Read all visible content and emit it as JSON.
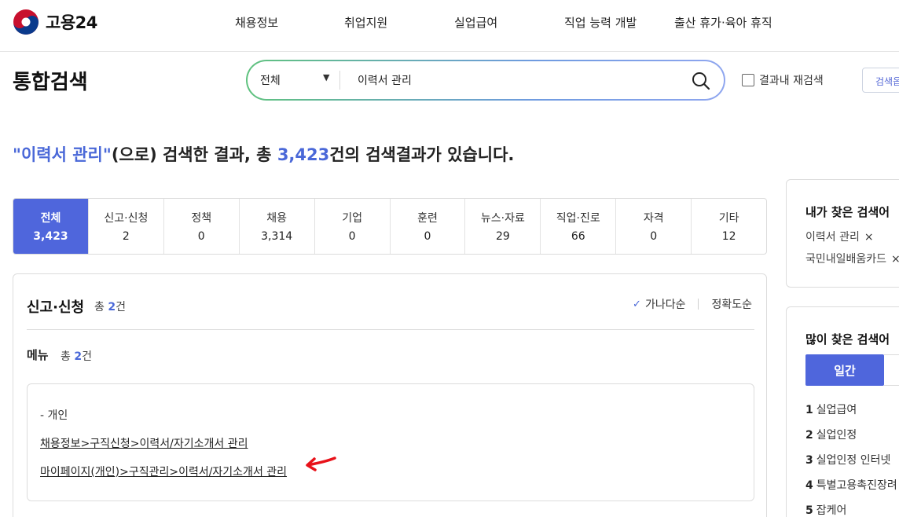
{
  "brand": {
    "name": "고용24",
    "accent": "#4f66dc"
  },
  "gnb": [
    "채용정보",
    "취업지원",
    "실업급여",
    "직업 능력 개발",
    "출산 휴가·육아 휴직"
  ],
  "page_title": "통합검색",
  "search": {
    "scope": "전체",
    "query": "이력서 관리",
    "recheck_label": "결과내 재검색",
    "option_label": "검색옵"
  },
  "result_summary": {
    "open_quote": "\"",
    "keyword": "이력서 관리",
    "close_quote": "\"",
    "mid": "(으로) 검색한 결과, 총 ",
    "total": "3,423",
    "tail": "건의 검색결과가 있습니다."
  },
  "tabs": [
    {
      "label": "전체",
      "count": "3,423",
      "active": true
    },
    {
      "label": "신고·신청",
      "count": "2"
    },
    {
      "label": "정책",
      "count": "0"
    },
    {
      "label": "채용",
      "count": "3,314"
    },
    {
      "label": "기업",
      "count": "0"
    },
    {
      "label": "훈련",
      "count": "0"
    },
    {
      "label": "뉴스·자료",
      "count": "29"
    },
    {
      "label": "직업·진로",
      "count": "66"
    },
    {
      "label": "자격",
      "count": "0"
    },
    {
      "label": "기타",
      "count": "12"
    }
  ],
  "section": {
    "title": "신고·신청",
    "total_prefix": "총 ",
    "total": "2",
    "total_suffix": "건",
    "sort_options": [
      "가나다순",
      "정확도순"
    ],
    "menu": {
      "title": "메뉴",
      "total_prefix": "총 ",
      "total": "2",
      "total_suffix": "건",
      "group": "- 개인",
      "links": [
        "채용정보>구직신청>이력서/자기소개서 관리",
        "마이페이지(개인)>구직관리>이력서/자기소개서 관리"
      ]
    }
  },
  "sidebar": {
    "recent_title": "내가 찾은 검색어",
    "recent": [
      "이력서 관리",
      "국민내일배움카드"
    ],
    "remove_glyph": "×",
    "popular_title": "많이 찾은 검색어",
    "period": "일간",
    "popular": [
      {
        "rank": "1",
        "term": "실업급여"
      },
      {
        "rank": "2",
        "term": "실업인정"
      },
      {
        "rank": "3",
        "term": "실업인정 인터넷"
      },
      {
        "rank": "4",
        "term": "특별고용촉진장려"
      },
      {
        "rank": "5",
        "term": "잡케어"
      }
    ]
  },
  "icons": {
    "logo": "taegeuk-logo-icon",
    "search": "search-icon",
    "dropdown": "triangle-down-icon",
    "sort_selected": "check-icon",
    "annotation": "red-arrow-icon"
  }
}
